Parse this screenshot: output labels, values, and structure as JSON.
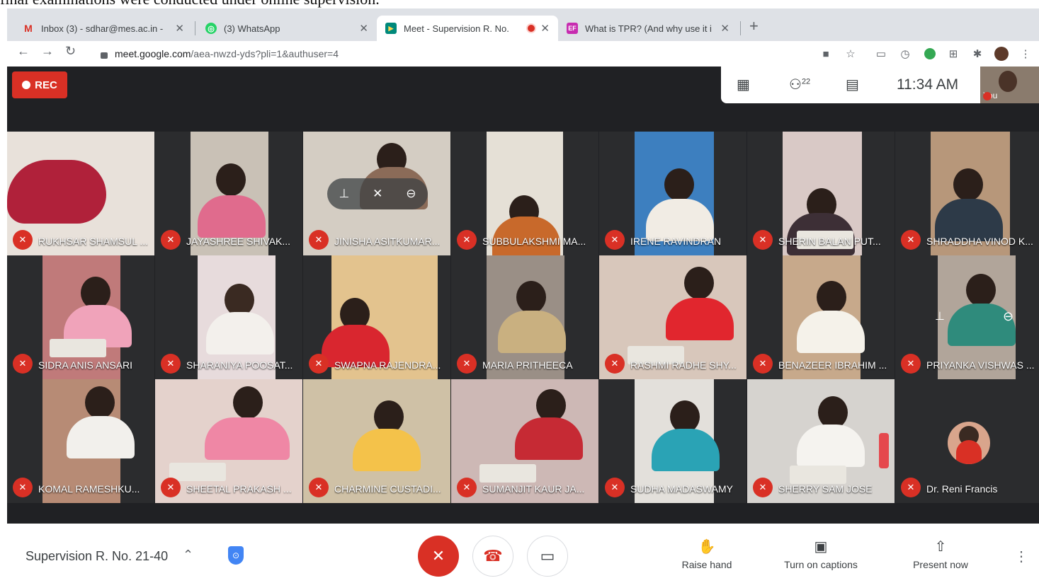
{
  "caption": "final examinations were conducted under online supervision.",
  "tabs": [
    {
      "title": "Inbox (3) - sdhar@mes.ac.in - ",
      "favicon": "gmail-icon",
      "color": "#d93025",
      "glyph": "M"
    },
    {
      "title": "(3) WhatsApp",
      "favicon": "whatsapp-icon",
      "color": "#25d366",
      "glyph": "◎"
    },
    {
      "title": "Meet - Supervision R. No. ",
      "favicon": "meet-icon",
      "color": "#00897b",
      "glyph": "▶"
    },
    {
      "title": "What is TPR? (And why use it i",
      "favicon": "ef-icon",
      "color": "#c72cb0",
      "glyph": "EF"
    }
  ],
  "new_tab_label": "+",
  "address": {
    "host": "meet.google.com",
    "path": "/aea-nwzd-yds?pli=1&authuser=4"
  },
  "meet": {
    "rec_label": "REC",
    "participant_count": "22",
    "time": "11:34 AM",
    "self_label": "You",
    "participants": [
      "RUKHSAR SHAMSUL ...",
      "JAYASHREE SHIVAK...",
      "JINISHA ASITKUMAR...",
      "SUBBULAKSHMI MA...",
      "IRENE RAVINDRAN",
      "SHERIN BALAN PUT...",
      "SHRADDHA VINOD K...",
      "SIDRA ANIS ANSARI",
      "SHARANIYA POOSAT...",
      "SWAPNA RAJENDRA...",
      "MARIA PRITHEECA",
      "RASHMI RADHE SHY...",
      "BENAZEER IBRAHIM ...",
      "PRIYANKA VISHWAS ...",
      "KOMAL RAMESHKU...",
      "SHEETAL PRAKASH ...",
      "CHARMINE CUSTADI...",
      "SUMANJIT KAUR JA...",
      "SUDHA MADASWAMY",
      "SHERRY SAM JOSE",
      "Dr. Reni Francis"
    ]
  },
  "bottom": {
    "meeting_title": "Supervision R. No. 21-40",
    "raise_hand": "Raise hand",
    "captions": "Turn on captions",
    "present": "Present now"
  }
}
